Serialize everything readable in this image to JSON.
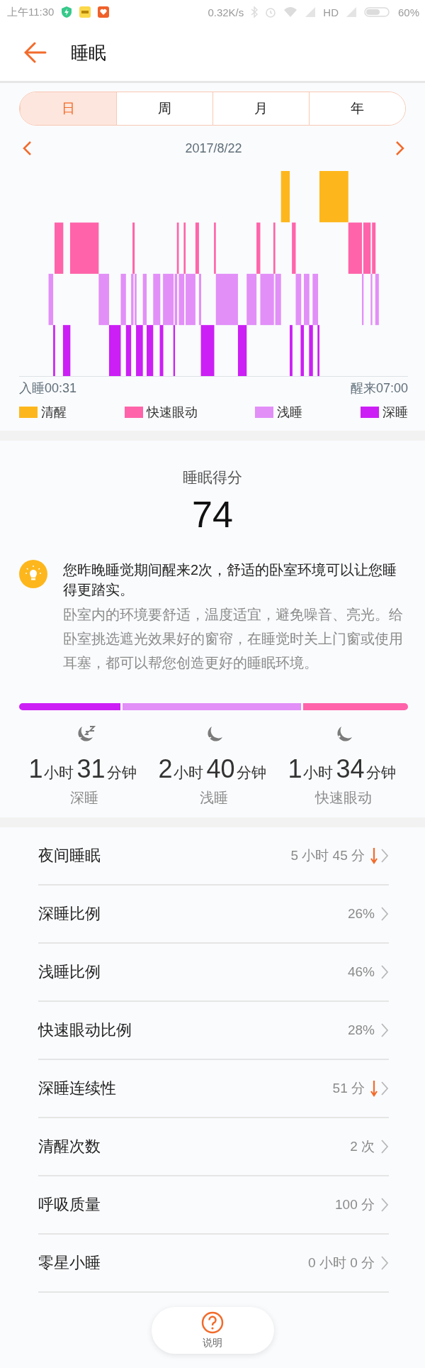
{
  "status_bar": {
    "time": "上午11:30",
    "net_speed": "0.32K/s",
    "network": "HD",
    "battery": "60%"
  },
  "header": {
    "title": "睡眠"
  },
  "tabs": [
    {
      "label": "日",
      "selected": true
    },
    {
      "label": "周",
      "selected": false
    },
    {
      "label": "月",
      "selected": false
    },
    {
      "label": "年",
      "selected": false
    }
  ],
  "date_nav": {
    "date": "2017/8/22"
  },
  "sleep_chart": {
    "start": "入睡00:31",
    "end": "醒来07:00",
    "legend": [
      {
        "label": "清醒",
        "color": "#fdb71c"
      },
      {
        "label": "快速眼动",
        "color": "#ff64aa"
      },
      {
        "label": "浅睡",
        "color": "#e28ff8"
      },
      {
        "label": "深睡",
        "color": "#cc1ff5"
      }
    ]
  },
  "score": {
    "title": "睡眠得分",
    "value": "74"
  },
  "tip": {
    "headline": "您昨晚睡觉期间醒来2次，舒适的卧室环境可以让您睡得更踏实。",
    "detail": "卧室内的环境要舒适，温度适宜，避免噪音、亮光。给卧室挑选遮光效果好的窗帘，在睡觉时关上门窗或使用耳塞，都可以帮您创造更好的睡眠环境。"
  },
  "stages": [
    {
      "kind": "deep",
      "parts": [
        "1",
        "小时",
        "31",
        "分钟"
      ],
      "label": "深睡",
      "color": "#cc1ff5"
    },
    {
      "kind": "light",
      "parts": [
        "2",
        "小时",
        "40",
        "分钟"
      ],
      "label": "浅睡",
      "color": "#e28ff8"
    },
    {
      "kind": "rem",
      "parts": [
        "1",
        "小时",
        "34",
        "分钟"
      ],
      "label": "快速眼动",
      "color": "#ff64aa"
    }
  ],
  "metrics": [
    {
      "label": "夜间睡眠",
      "value": "5 小时 45 分",
      "declined": true
    },
    {
      "label": "深睡比例",
      "value": "26%",
      "declined": false
    },
    {
      "label": "浅睡比例",
      "value": "46%",
      "declined": false
    },
    {
      "label": "快速眼动比例",
      "value": "28%",
      "declined": false
    },
    {
      "label": "深睡连续性",
      "value": "51 分",
      "declined": true
    },
    {
      "label": "清醒次数",
      "value": "2 次",
      "declined": false
    },
    {
      "label": "呼吸质量",
      "value": "100 分",
      "declined": false
    },
    {
      "label": "零星小睡",
      "value": "0 小时 0 分",
      "declined": false
    }
  ],
  "help_button": {
    "label": "说明"
  }
}
